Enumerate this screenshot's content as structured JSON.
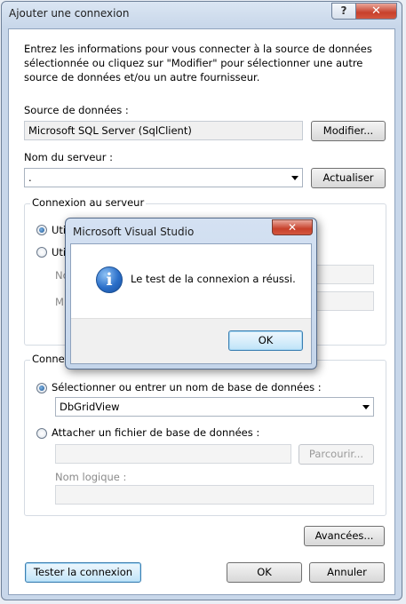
{
  "window": {
    "title": "Ajouter une connexion",
    "help_label": "?",
    "close_label": "✕"
  },
  "intro_text": "Entrez les informations pour vous connecter à la source de données sélectionnée ou cliquez sur \"Modifier\" pour sélectionner une autre source de données et/ou un autre fournisseur.",
  "datasource": {
    "label": "Source de données :",
    "value": "Microsoft SQL Server (SqlClient)",
    "modify_button": "Modifier..."
  },
  "server": {
    "label": "Nom du serveur :",
    "value": ".",
    "refresh_button": "Actualiser"
  },
  "login_group": {
    "title": "Connexion au serveur",
    "option1_partial": "Util",
    "option2_partial": "Util",
    "field1_partial": "No",
    "field2_partial": "M"
  },
  "db_group": {
    "title_partial": "Connex",
    "select_option": "Sélectionner ou entrer un nom de base de données :",
    "db_value": "DbGridView",
    "attach_option": "Attacher un fichier de base de données :",
    "browse_button": "Parcourir...",
    "logical_name_label": "Nom logique :"
  },
  "advanced_button": "Avancées...",
  "footer": {
    "test_button": "Tester la connexion",
    "ok_button": "OK",
    "cancel_button": "Annuler"
  },
  "modal": {
    "title": "Microsoft Visual Studio",
    "close_label": "✕",
    "icon_glyph": "i",
    "message": "Le test de la connexion a réussi.",
    "ok_button": "OK"
  }
}
